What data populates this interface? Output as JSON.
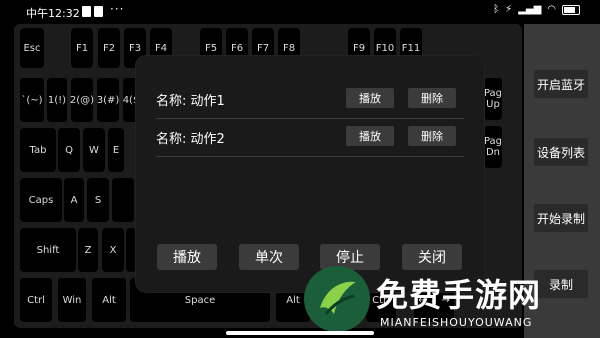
{
  "status_bar": {
    "time": "中午12:32",
    "dots": "···",
    "battery": "battery"
  },
  "keyboard": {
    "keys": {
      "esc": "Esc",
      "f1": "F1",
      "f2": "F2",
      "f3": "F3",
      "f4": "F4",
      "f5": "F5",
      "f6": "F6",
      "f7": "F7",
      "f8": "F8",
      "f9": "F9",
      "f10": "F10",
      "f11": "F11",
      "tilde": "`(~)",
      "k1": "1(!)",
      "k2": "2(@)",
      "k3": "3(#)",
      "k4": "4($",
      "pgup": "Pag Up",
      "pgdn": "Pag Dn",
      "tab": "Tab",
      "q": "Q",
      "w": "W",
      "e": "E",
      "caps": "Caps",
      "a": "A",
      "s": "S",
      "shift": "Shift",
      "z": "Z",
      "x": "X",
      "ctrl": "Ctrl",
      "win": "Win",
      "alt": "Alt",
      "space": "Space",
      "alt_r": "Alt",
      "ctrl_r": "Ctrl",
      "arrows": "← ↓ →"
    }
  },
  "side_panel": {
    "buttons": [
      "开启蓝牙",
      "设备列表",
      "开始录制",
      "录制"
    ]
  },
  "dialog": {
    "items": [
      {
        "label": "名称: 动作1",
        "play": "播放",
        "delete": "删除"
      },
      {
        "label": "名称: 动作2",
        "play": "播放",
        "delete": "删除"
      }
    ],
    "buttons": {
      "play": "播放",
      "once": "单次",
      "stop": "停止",
      "close": "关闭"
    }
  },
  "watermark": {
    "title": "免费手游网",
    "subtitle": "MIANFEISHOUYOUWANG"
  }
}
